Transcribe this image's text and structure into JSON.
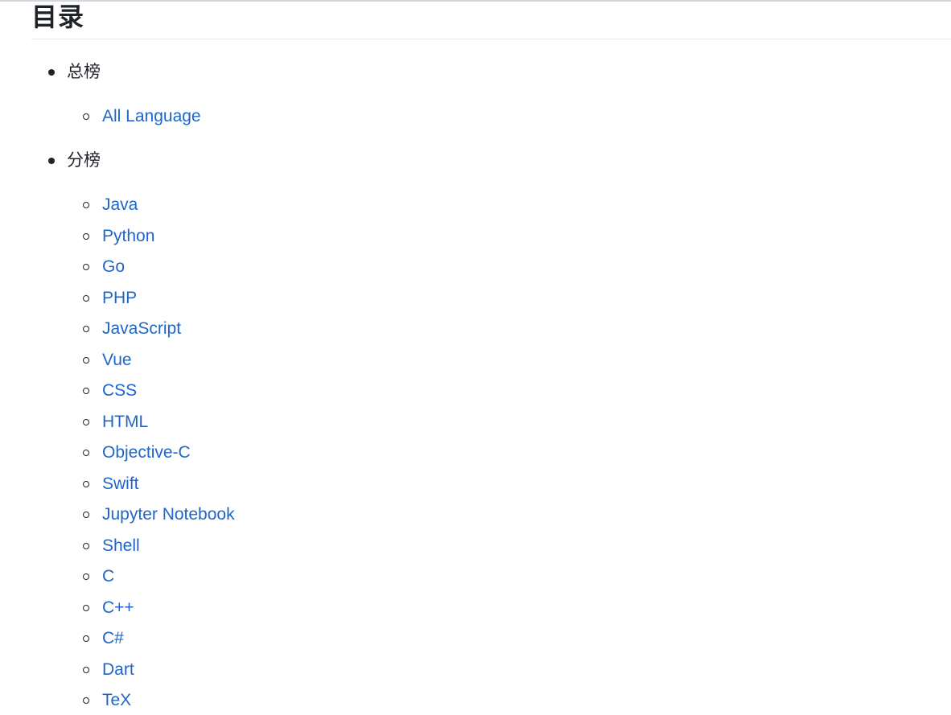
{
  "heading": "目录",
  "sections": [
    {
      "label": "总榜",
      "items": [
        "All Language"
      ]
    },
    {
      "label": "分榜",
      "items": [
        "Java",
        "Python",
        "Go",
        "PHP",
        "JavaScript",
        "Vue",
        "CSS",
        "HTML",
        "Objective-C",
        "Swift",
        "Jupyter Notebook",
        "Shell",
        "C",
        "C++",
        "C#",
        "Dart",
        "TeX"
      ]
    }
  ],
  "colors": {
    "text": "#1f2328",
    "link": "#1f66c9",
    "rule": "#e6e8eb"
  }
}
